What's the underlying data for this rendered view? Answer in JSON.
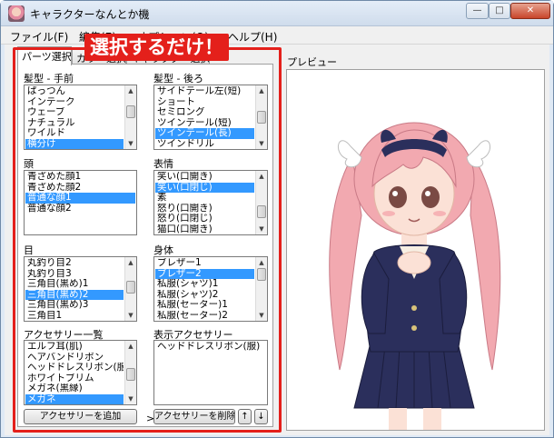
{
  "window": {
    "title": "キャラクターなんとか機",
    "controls": {
      "minimize": "—",
      "maximize": "□",
      "close": "✕"
    }
  },
  "menu": {
    "file": "ファイル(F)",
    "edit": "編集(E)",
    "options": "オプション(O)",
    "help": "ヘルプ(H)"
  },
  "annotation": {
    "callout": "選択するだけ！"
  },
  "tabs": [
    {
      "label": "パーツ選択",
      "active": true
    },
    {
      "label": "カラー選択",
      "active": false
    },
    {
      "label": "キャラクター選択",
      "active": false
    }
  ],
  "sections": {
    "front_hair": {
      "label": "髪型 - 手前",
      "items": [
        "ぱっつん",
        "インテーク",
        "ウェーブ",
        "ナチュラル",
        "ワイルド",
        "横分け"
      ],
      "selected_index": 5
    },
    "back_hair": {
      "label": "髪型 - 後ろ",
      "items": [
        "サイドテール左(短)",
        "ショート",
        "セミロング",
        "ツインテール(短)",
        "ツインテール(長)",
        "ツインドリル"
      ],
      "selected_index": 4
    },
    "head": {
      "label": "頭",
      "items": [
        "青ざめた顔1",
        "青ざめた顔2",
        "普通な顔1",
        "普通な顔2"
      ],
      "selected_index": 2
    },
    "expression": {
      "label": "表情",
      "items": [
        "笑い(口開き)",
        "笑い(口閉じ)",
        "素",
        "怒り(口開き)",
        "怒り(口閉じ)",
        "猫口(口開き)"
      ],
      "selected_index": 1
    },
    "eyes": {
      "label": "目",
      "items": [
        "丸釣り目2",
        "丸釣り目3",
        "三角目(黒め)1",
        "三角目(黒め)2",
        "三角目(黒め)3",
        "三角目1"
      ],
      "selected_index": 3
    },
    "body": {
      "label": "身体",
      "items": [
        "ブレザー1",
        "ブレザー2",
        "私服(シャツ)1",
        "私服(シャツ)2",
        "私服(セーター)1",
        "私服(セーター)2"
      ],
      "selected_index": 1
    },
    "accessory_list": {
      "label": "アクセサリー一覧",
      "items": [
        "エルフ耳(肌)",
        "ヘアバンドリボン",
        "ヘッドドレスリボン(服)",
        "ホワイトブリム",
        "メガネ(黒縁)",
        "メガネ"
      ],
      "selected_index": 5
    },
    "shown_accessories": {
      "label": "表示アクセサリー",
      "items": [
        "ヘッドドレスリボン(服)"
      ],
      "selected_index": -1
    }
  },
  "transfer_arrow": ">",
  "buttons": {
    "add_accessory": "アクセサリーを追加",
    "remove_accessory": "アクセサリーを削除",
    "move_up": "↑",
    "move_down": "↓"
  },
  "preview": {
    "label": "プレビュー"
  },
  "colors": {
    "selection": "#3399ff",
    "annotation_red": "#e4201b",
    "hair_pink": "#f2a9b0",
    "uniform_navy": "#2b2f5c"
  }
}
